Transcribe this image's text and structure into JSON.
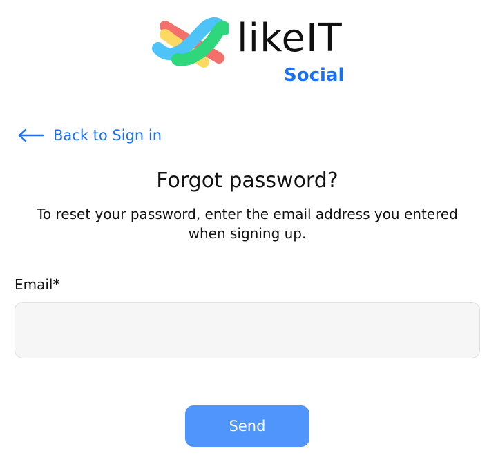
{
  "brand": {
    "name": "likeIT",
    "subtitle": "Social",
    "logo_icon": "likeit-logo-icon",
    "colors": {
      "red": "#f4706b",
      "yellow": "#fcd963",
      "blue": "#4dc3f7",
      "green": "#2ed67c",
      "subtitle": "#1a6ff2"
    }
  },
  "back_link": {
    "label": "Back to Sign in",
    "icon": "arrow-left-icon"
  },
  "title": "Forgot password?",
  "description": "To reset your password, enter the email address you entered when signing up.",
  "form": {
    "email_label": "Email*",
    "email_value": "",
    "email_placeholder": ""
  },
  "send_button": {
    "label": "Send"
  },
  "colors": {
    "accent": "#1a6ff2",
    "button": "#4f95fb",
    "input_bg": "#f6f6f6"
  }
}
